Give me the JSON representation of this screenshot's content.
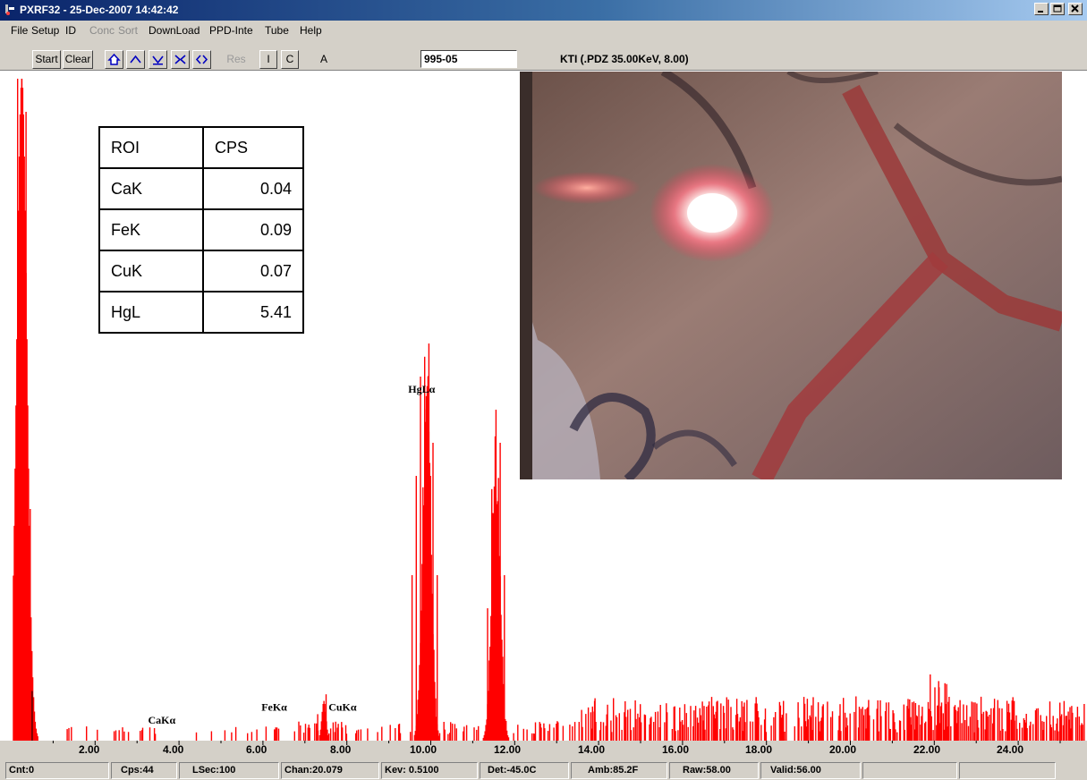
{
  "window": {
    "title": "PXRF32 - 25-Dec-2007 14:42:42"
  },
  "menu": [
    {
      "label": "File",
      "enabled": true
    },
    {
      "label": "Setup",
      "enabled": true
    },
    {
      "label": "ID",
      "enabled": true
    },
    {
      "label": "Conc",
      "enabled": false
    },
    {
      "label": "Sort",
      "enabled": false
    },
    {
      "label": "DownLoad",
      "enabled": true
    },
    {
      "label": "PPD-Inte",
      "enabled": true
    },
    {
      "label": "Tube",
      "enabled": true
    },
    {
      "label": "Help",
      "enabled": true
    }
  ],
  "toolbar": {
    "start_label": "Start",
    "clear_label": "Clear",
    "res_label": "Res",
    "i_label": "I",
    "c_label": "C",
    "a_label": "A",
    "sample_value": "995-05",
    "status_text": "KTI  (.PDZ 35.00KeV, 8.00)"
  },
  "roi_table": {
    "headers": [
      "ROI",
      "CPS"
    ],
    "rows": [
      [
        "CaK",
        "0.04"
      ],
      [
        "FeK",
        "0.09"
      ],
      [
        "CuK",
        "0.07"
      ],
      [
        "HgL",
        "5.41"
      ]
    ]
  },
  "peak_labels": [
    {
      "label": "HgLα",
      "kev": 9.9,
      "count": 0.52
    },
    {
      "label": "FeKα",
      "kev": 6.4,
      "count": 0.04
    },
    {
      "label": "CuKα",
      "kev": 8.0,
      "count": 0.04
    },
    {
      "label": "CaKα",
      "kev": 3.7,
      "count": 0.02
    }
  ],
  "axis": {
    "ticks": [
      "2.00",
      "4.00",
      "6.00",
      "8.00",
      "10.00",
      "12.00",
      "14.00",
      "16.00",
      "18.00",
      "20.00",
      "22.00",
      "24.00"
    ]
  },
  "chart_data": {
    "type": "bar",
    "xlabel": "",
    "ylabel": "",
    "xlim": [
      0,
      25.6
    ],
    "ylim": [
      0,
      1
    ],
    "series": [
      {
        "values_by_kev": [
          [
            0.15,
            1.0
          ],
          [
            0.25,
            1.0
          ],
          [
            0.35,
            0.95
          ],
          [
            0.45,
            0.35
          ],
          [
            3.3,
            0.02
          ],
          [
            6.3,
            0.02
          ],
          [
            7.3,
            0.04
          ],
          [
            7.5,
            0.07
          ],
          [
            9.55,
            0.25
          ],
          [
            9.65,
            0.4
          ],
          [
            9.75,
            0.55
          ],
          [
            9.85,
            0.58
          ],
          [
            9.95,
            0.6
          ],
          [
            10.05,
            0.45
          ],
          [
            10.15,
            0.25
          ],
          [
            11.35,
            0.2
          ],
          [
            11.45,
            0.38
          ],
          [
            11.55,
            0.5
          ],
          [
            11.65,
            0.45
          ],
          [
            11.75,
            0.25
          ],
          [
            13.9,
            0.06
          ],
          [
            18.4,
            0.06
          ],
          [
            21.9,
            0.1
          ],
          [
            22.1,
            0.09
          ],
          [
            23.9,
            0.06
          ]
        ]
      }
    ]
  },
  "colors": {
    "spectrum": "#ff0000",
    "chrome": "#d4d0c8",
    "titlebar": "#0a246a"
  },
  "statusbar": [
    "Cnt:0",
    "Cps:44",
    "LSec:100",
    "Chan:20.079",
    "Kev: 0.5100",
    "Det:-45.0C",
    "Amb:85.2F",
    "Raw:58.00",
    "Valid:56.00",
    "",
    ""
  ]
}
